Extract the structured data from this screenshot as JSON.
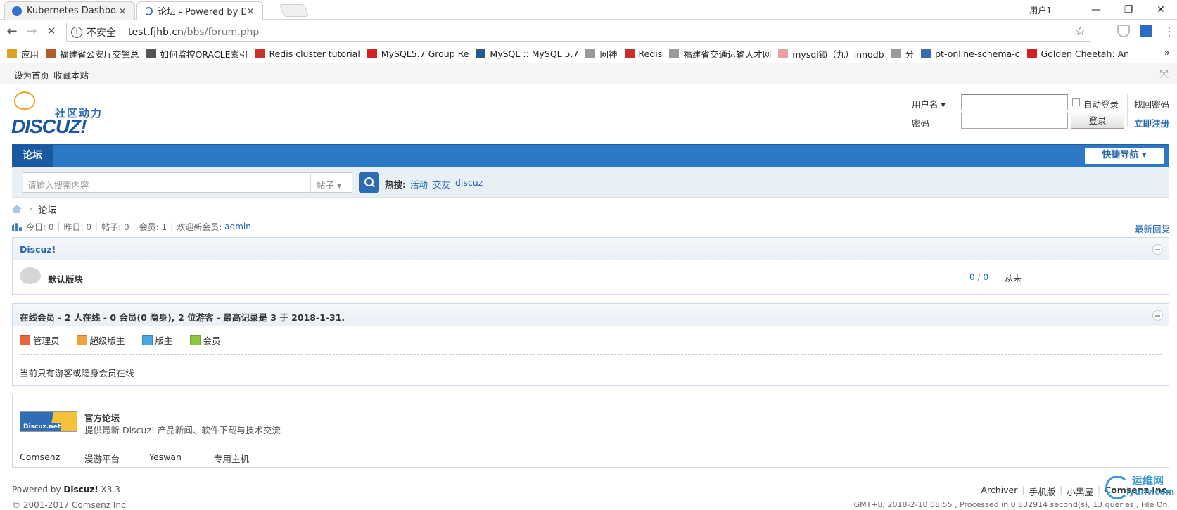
{
  "browser": {
    "tabs": [
      {
        "title": "Kubernetes Dashboard",
        "close": "×"
      },
      {
        "title": "论坛 - Powered by Disc",
        "close": "×"
      }
    ],
    "user_label": "用户1",
    "minimize": "—",
    "restore": "❐",
    "close": "✕",
    "back": "←",
    "forward": "→",
    "stop": "✕",
    "omnibox": {
      "security": "不安全",
      "host": "test.fjhb.cn",
      "path": "/bbs/forum.php",
      "star": "☆"
    },
    "bookmarks": [
      {
        "label": "应用",
        "color": "#e0a020"
      },
      {
        "label": "福建省公安厅交警总",
        "color": "#b55a2a"
      },
      {
        "label": "如何监控ORACLE索引",
        "color": "#555555"
      },
      {
        "label": "Redis cluster tutorial",
        "color": "#c8302a"
      },
      {
        "label": "MySQL5.7 Group Re",
        "color": "#d42020"
      },
      {
        "label": "MySQL :: MySQL 5.7",
        "color": "#2a5a8a"
      },
      {
        "label": "网神",
        "color": "#999999"
      },
      {
        "label": "Redis",
        "color": "#c8302a"
      },
      {
        "label": "福建省交通运输人才网",
        "color": "#999999"
      },
      {
        "label": "mysql锁（九）innodb",
        "color": "#e8a0a0"
      },
      {
        "label": "分",
        "color": "#999999"
      },
      {
        "label": "pt-online-schema-c",
        "color": "#3a6ab0"
      },
      {
        "label": "Golden Cheetah: An",
        "color": "#d42020"
      }
    ],
    "bookmarks_more": "»"
  },
  "toplinks": {
    "set_home": "设为首页",
    "bookmark": "收藏本站",
    "close": "⤧"
  },
  "logo": {
    "slogan": "社区动力",
    "brand": "DISCUZ!"
  },
  "login": {
    "username_label": "用户名 ▾",
    "password_label": "密码",
    "auto_login": "自动登录",
    "login_button": "登录",
    "forgot": "找回密码",
    "register": "立即注册"
  },
  "nav": {
    "current": "论坛",
    "quick_nav": "快捷导航 ▾"
  },
  "search": {
    "placeholder": "请输入搜索内容",
    "type": "帖子 ▾",
    "hot_label": "热搜:",
    "hot_words": [
      "活动",
      "交友",
      "discuz"
    ]
  },
  "breadcrumb": {
    "chevron": "›",
    "current": "论坛"
  },
  "stats": {
    "today": "今日: 0",
    "yesterday": "昨日: 0",
    "posts": "帖子: 0",
    "members": "会员: 1",
    "welcome": "欢迎新会员:",
    "newest": "admin",
    "divider": "|",
    "latest_reply": "最新回复"
  },
  "category": {
    "title": "Discuz!",
    "forums": [
      {
        "name": "默认版块",
        "threads": "0",
        "sep": " / ",
        "posts": "0",
        "last": "从未"
      }
    ]
  },
  "online": {
    "title": "在线会员 - 2 人在线 - 0 会员(0 隐身), 2 位游客 - 最高记录是 3 于 2018-1-31.",
    "legend": [
      {
        "label": "管理员",
        "color": "#e8643a"
      },
      {
        "label": "超级版主",
        "color": "#f0a23c"
      },
      {
        "label": "版主",
        "color": "#4aa8e0"
      },
      {
        "label": "会员",
        "color": "#8cc63e"
      }
    ],
    "note": "当前只有游客或隐身会员在线"
  },
  "partners": {
    "logo_text": "Discuz.net",
    "title": "官方论坛",
    "desc": "提供最新 Discuz! 产品新闻、软件下载与技术交流",
    "links": [
      "Comsenz",
      "漫游平台",
      "Yeswan",
      "专用主机"
    ]
  },
  "footer": {
    "powered_prefix": "Powered by ",
    "powered_brand": "Discuz!",
    "version": "X3.3",
    "copyright": "© 2001-2017 Comsenz Inc.",
    "links": [
      "Archiver",
      "手机版",
      "小黑屋",
      "Comsenz Inc."
    ],
    "gmt": "GMT+8, 2018-2-10 08:55 , Processed in 0.832914 second(s), 13 queries , File On."
  },
  "watermark": {
    "line1": "运维网",
    "line2": "iyunv.com"
  }
}
